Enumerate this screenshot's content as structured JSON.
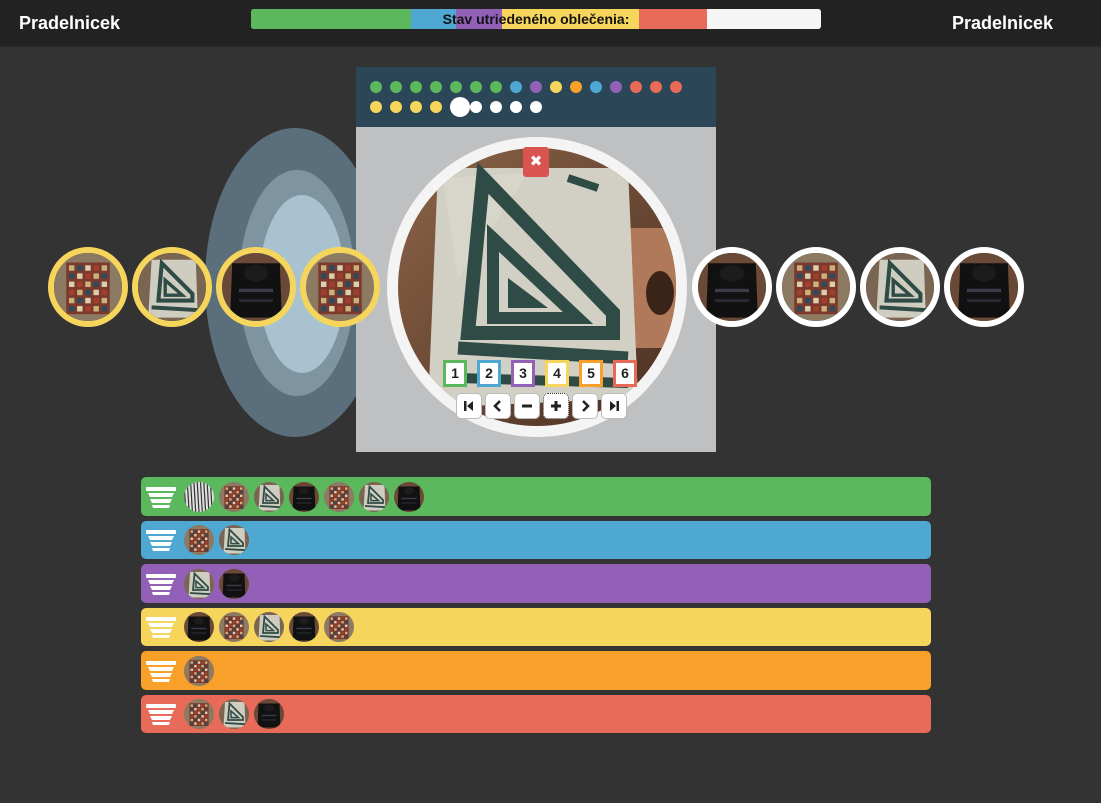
{
  "header": {
    "brand_left": "Pradelnicek",
    "brand_right": "Pradelnicek",
    "progress_label": "Stav utriedeného oblečenia:"
  },
  "progress": [
    {
      "color": "#5cb85c",
      "fraction": 0.28
    },
    {
      "color": "#4ea8d2",
      "fraction": 0.08
    },
    {
      "color": "#9360b8",
      "fraction": 0.08
    },
    {
      "color": "#f6d55c",
      "fraction": 0.24
    },
    {
      "color": "#e86a58",
      "fraction": 0.12
    },
    {
      "color": "#f5f5f5",
      "fraction": 0.2
    }
  ],
  "status_dots": [
    "green",
    "green",
    "green",
    "green",
    "green",
    "green",
    "green",
    "blue",
    "purple",
    "yellow",
    "orange",
    "blue",
    "purple",
    "red",
    "red",
    "red",
    "yellow",
    "yellow",
    "yellow",
    "yellow",
    "current",
    "white",
    "white",
    "white",
    "white"
  ],
  "colors": {
    "green": "#5cb85c",
    "blue": "#4ea8d2",
    "purple": "#9360b8",
    "yellow": "#f6d55c",
    "orange": "#f9a02a",
    "red": "#e86a58",
    "white": "#ffffff",
    "current": "#ffffff"
  },
  "current_item": {
    "close_label": "✖",
    "category_buttons": [
      {
        "label": "1",
        "color": "green"
      },
      {
        "label": "2",
        "color": "blue"
      },
      {
        "label": "3",
        "color": "purple"
      },
      {
        "label": "4",
        "color": "yellow"
      },
      {
        "label": "5",
        "color": "orange"
      },
      {
        "label": "6",
        "color": "red"
      }
    ],
    "nav_buttons": [
      "first-icon",
      "prev-icon",
      "minus-icon",
      "plus-icon",
      "next-icon",
      "last-icon"
    ]
  },
  "sorted_queue": [
    {
      "photo": "check-shirt",
      "ring": "yellow"
    },
    {
      "photo": "stripe-shirt",
      "ring": "yellow"
    },
    {
      "photo": "dark-shirt",
      "ring": "yellow"
    },
    {
      "photo": "check-shirt",
      "ring": "yellow"
    }
  ],
  "unsorted_queue": [
    {
      "photo": "dark-shirt",
      "ring": "white"
    },
    {
      "photo": "check-shirt",
      "ring": "white"
    },
    {
      "photo": "stripe-shirt",
      "ring": "white"
    },
    {
      "photo": "dark-shirt",
      "ring": "white"
    }
  ],
  "baskets": [
    {
      "color": "green",
      "items": [
        "zebra-shirt",
        "check-shirt",
        "stripe-shirt",
        "dark-shirt",
        "check-shirt",
        "stripe-shirt",
        "dark-shirt"
      ]
    },
    {
      "color": "blue",
      "items": [
        "check-shirt",
        "stripe-shirt"
      ]
    },
    {
      "color": "purple",
      "items": [
        "stripe-shirt",
        "dark-shirt"
      ]
    },
    {
      "color": "yellow",
      "items": [
        "dark-shirt",
        "check-shirt",
        "stripe-shirt",
        "dark-shirt",
        "check-shirt"
      ]
    },
    {
      "color": "orange",
      "items": [
        "check-shirt"
      ]
    },
    {
      "color": "red",
      "items": [
        "check-shirt",
        "stripe-shirt",
        "dark-shirt"
      ]
    }
  ]
}
